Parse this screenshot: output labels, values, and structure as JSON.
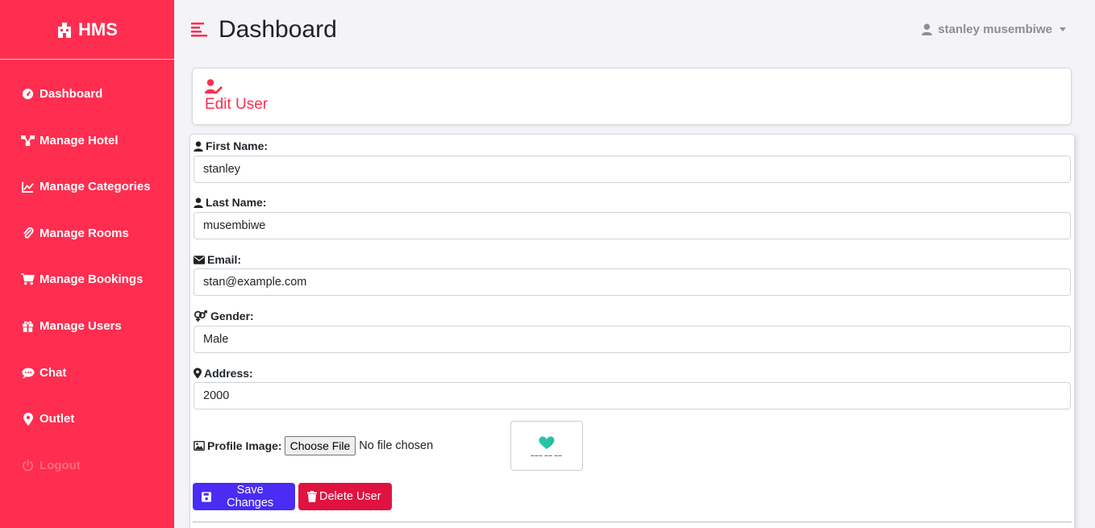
{
  "brand": {
    "name": "HMS",
    "icon": "hotel-icon"
  },
  "sidebar": {
    "items": [
      {
        "label": "Dashboard",
        "icon": "gauge-icon"
      },
      {
        "label": "Manage Hotel",
        "icon": "network-icon"
      },
      {
        "label": "Manage Categories",
        "icon": "chart-line-icon"
      },
      {
        "label": "Manage Rooms",
        "icon": "paperclip-icon"
      },
      {
        "label": "Manage Bookings",
        "icon": "cart-icon"
      },
      {
        "label": "Manage Users",
        "icon": "gift-icon"
      },
      {
        "label": "Chat",
        "icon": "chat-icon"
      },
      {
        "label": "Outlet",
        "icon": "map-pin-icon"
      },
      {
        "label": "Logout",
        "icon": "power-icon"
      }
    ]
  },
  "header": {
    "title": "Dashboard",
    "user_name": "stanley musembiwe"
  },
  "card": {
    "title": "Edit User"
  },
  "form": {
    "first_name": {
      "label": "First Name:",
      "value": "stanley"
    },
    "last_name": {
      "label": "Last Name:",
      "value": "musembiwe"
    },
    "email": {
      "label": "Email:",
      "value": "stan@example.com"
    },
    "gender": {
      "label": "Gender:",
      "value": "Male"
    },
    "address": {
      "label": "Address:",
      "value": "2000"
    },
    "profile_image": {
      "label": "Profile Image:",
      "button": "Choose File",
      "status": "No file chosen"
    },
    "save_label": "Save Changes",
    "delete_label": "Delete User"
  },
  "colors": {
    "sidebar": "#ff2d4f",
    "accent": "#ff2d4f",
    "save": "#4a2cf5",
    "delete": "#e0123f"
  }
}
